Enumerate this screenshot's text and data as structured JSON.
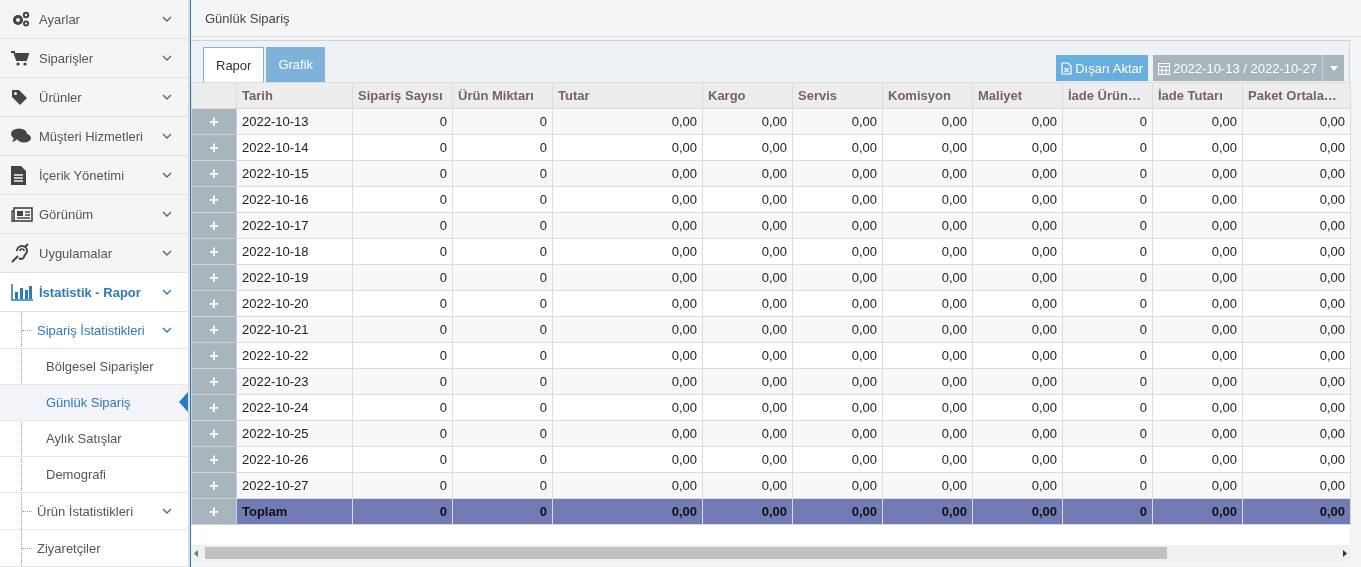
{
  "sidebar": {
    "items": [
      {
        "label": "Ayarlar",
        "selected": false
      },
      {
        "label": "Siparişler",
        "selected": false
      },
      {
        "label": "Ürünler",
        "selected": false
      },
      {
        "label": "Müşteri Hizmetleri",
        "selected": false
      },
      {
        "label": "İçerik Yönetimi",
        "selected": false
      },
      {
        "label": "Görünüm",
        "selected": false
      },
      {
        "label": "Uygulamalar",
        "selected": false
      },
      {
        "label": "İstatistik - Rapor",
        "selected": true,
        "children": [
          {
            "label": "Sipariş İstatistikleri",
            "selected": true,
            "children": [
              {
                "label": "Bölgesel Siparişler",
                "selected": false
              },
              {
                "label": "Günlük Sipariş",
                "selected": true
              },
              {
                "label": "Aylık Satışlar",
                "selected": false
              },
              {
                "label": "Demografi",
                "selected": false
              }
            ]
          },
          {
            "label": "Ürün İstatistikleri",
            "selected": false,
            "has_submenu": true
          },
          {
            "label": "Ziyaretçiler",
            "selected": false
          }
        ]
      }
    ]
  },
  "page_title": "Günlük Sipariş",
  "tabs": [
    {
      "label": "Rapor",
      "selected": true
    },
    {
      "label": "Grafik",
      "selected": false
    }
  ],
  "export_button": "Dışarı Aktar",
  "date_range": "2022-10-13 / 2022-10-27",
  "table": {
    "columns": [
      "Tarih",
      "Sipariş Sayısı",
      "Ürün Miktarı",
      "Tutar",
      "Kargo",
      "Servis",
      "Komisyon",
      "Maliyet",
      "İade Ürün…",
      "İade Tutarı",
      "Paket Ortala…"
    ],
    "rows": [
      {
        "expand": "+",
        "cells": [
          "2022-10-13",
          "0",
          "0",
          "0,00",
          "0,00",
          "0,00",
          "0,00",
          "0,00",
          "0",
          "0,00",
          "0,00"
        ]
      },
      {
        "expand": "+",
        "cells": [
          "2022-10-14",
          "0",
          "0",
          "0,00",
          "0,00",
          "0,00",
          "0,00",
          "0,00",
          "0",
          "0,00",
          "0,00"
        ]
      },
      {
        "expand": "+",
        "cells": [
          "2022-10-15",
          "0",
          "0",
          "0,00",
          "0,00",
          "0,00",
          "0,00",
          "0,00",
          "0",
          "0,00",
          "0,00"
        ]
      },
      {
        "expand": "+",
        "cells": [
          "2022-10-16",
          "0",
          "0",
          "0,00",
          "0,00",
          "0,00",
          "0,00",
          "0,00",
          "0",
          "0,00",
          "0,00"
        ]
      },
      {
        "expand": "+",
        "cells": [
          "2022-10-17",
          "0",
          "0",
          "0,00",
          "0,00",
          "0,00",
          "0,00",
          "0,00",
          "0",
          "0,00",
          "0,00"
        ]
      },
      {
        "expand": "+",
        "cells": [
          "2022-10-18",
          "0",
          "0",
          "0,00",
          "0,00",
          "0,00",
          "0,00",
          "0,00",
          "0",
          "0,00",
          "0,00"
        ]
      },
      {
        "expand": "+",
        "cells": [
          "2022-10-19",
          "0",
          "0",
          "0,00",
          "0,00",
          "0,00",
          "0,00",
          "0,00",
          "0",
          "0,00",
          "0,00"
        ]
      },
      {
        "expand": "+",
        "cells": [
          "2022-10-20",
          "0",
          "0",
          "0,00",
          "0,00",
          "0,00",
          "0,00",
          "0,00",
          "0",
          "0,00",
          "0,00"
        ]
      },
      {
        "expand": "+",
        "cells": [
          "2022-10-21",
          "0",
          "0",
          "0,00",
          "0,00",
          "0,00",
          "0,00",
          "0,00",
          "0",
          "0,00",
          "0,00"
        ]
      },
      {
        "expand": "+",
        "cells": [
          "2022-10-22",
          "0",
          "0",
          "0,00",
          "0,00",
          "0,00",
          "0,00",
          "0,00",
          "0",
          "0,00",
          "0,00"
        ]
      },
      {
        "expand": "+",
        "cells": [
          "2022-10-23",
          "0",
          "0",
          "0,00",
          "0,00",
          "0,00",
          "0,00",
          "0,00",
          "0",
          "0,00",
          "0,00"
        ]
      },
      {
        "expand": "+",
        "cells": [
          "2022-10-24",
          "0",
          "0",
          "0,00",
          "0,00",
          "0,00",
          "0,00",
          "0,00",
          "0",
          "0,00",
          "0,00"
        ]
      },
      {
        "expand": "+",
        "cells": [
          "2022-10-25",
          "0",
          "0",
          "0,00",
          "0,00",
          "0,00",
          "0,00",
          "0,00",
          "0",
          "0,00",
          "0,00"
        ]
      },
      {
        "expand": "+",
        "cells": [
          "2022-10-26",
          "0",
          "0",
          "0,00",
          "0,00",
          "0,00",
          "0,00",
          "0,00",
          "0",
          "0,00",
          "0,00"
        ]
      },
      {
        "expand": "+",
        "cells": [
          "2022-10-27",
          "0",
          "0",
          "0,00",
          "0,00",
          "0,00",
          "0,00",
          "0,00",
          "0",
          "0,00",
          "0,00"
        ]
      }
    ],
    "total_row": {
      "expand": "+",
      "cells": [
        "Toplam",
        "0",
        "0",
        "0,00",
        "0,00",
        "0,00",
        "0,00",
        "0,00",
        "0",
        "0,00",
        "0,00"
      ]
    }
  }
}
